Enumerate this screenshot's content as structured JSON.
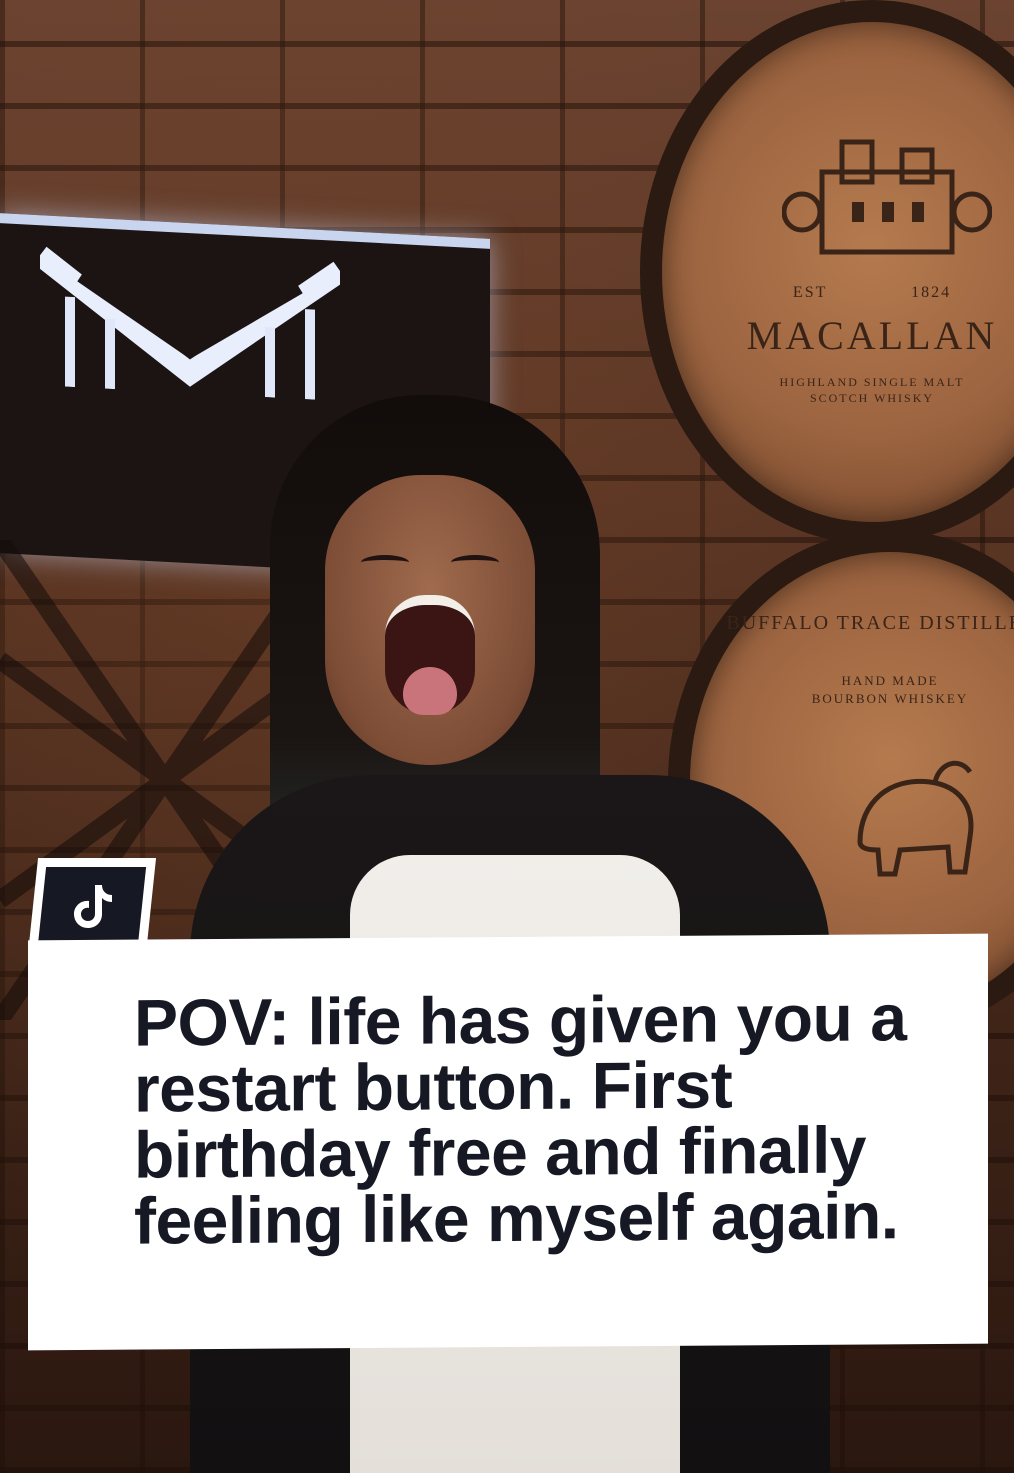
{
  "scene": {
    "macallan_barrel": {
      "brand": "MACALLAN",
      "est_left": "EST",
      "est_right": "1824",
      "sub_lines": "HIGHLAND SINGLE MALT\nSCOTCH WHISKY"
    },
    "buffalo_barrel": {
      "arc_text": "BUFFALO TRACE DISTILLERY",
      "sub_lines": "HAND MADE\nBOURBON WHISKEY"
    }
  },
  "overlay": {
    "logo_icon": "tiktok-logo-icon",
    "caption": "POV: life has given you a\nrestart button. First\nbirthday free and finally\nfeeling like myself again."
  },
  "colors": {
    "caption_text": "#161823",
    "caption_bg": "#ffffff",
    "badge_bg": "#161823"
  }
}
